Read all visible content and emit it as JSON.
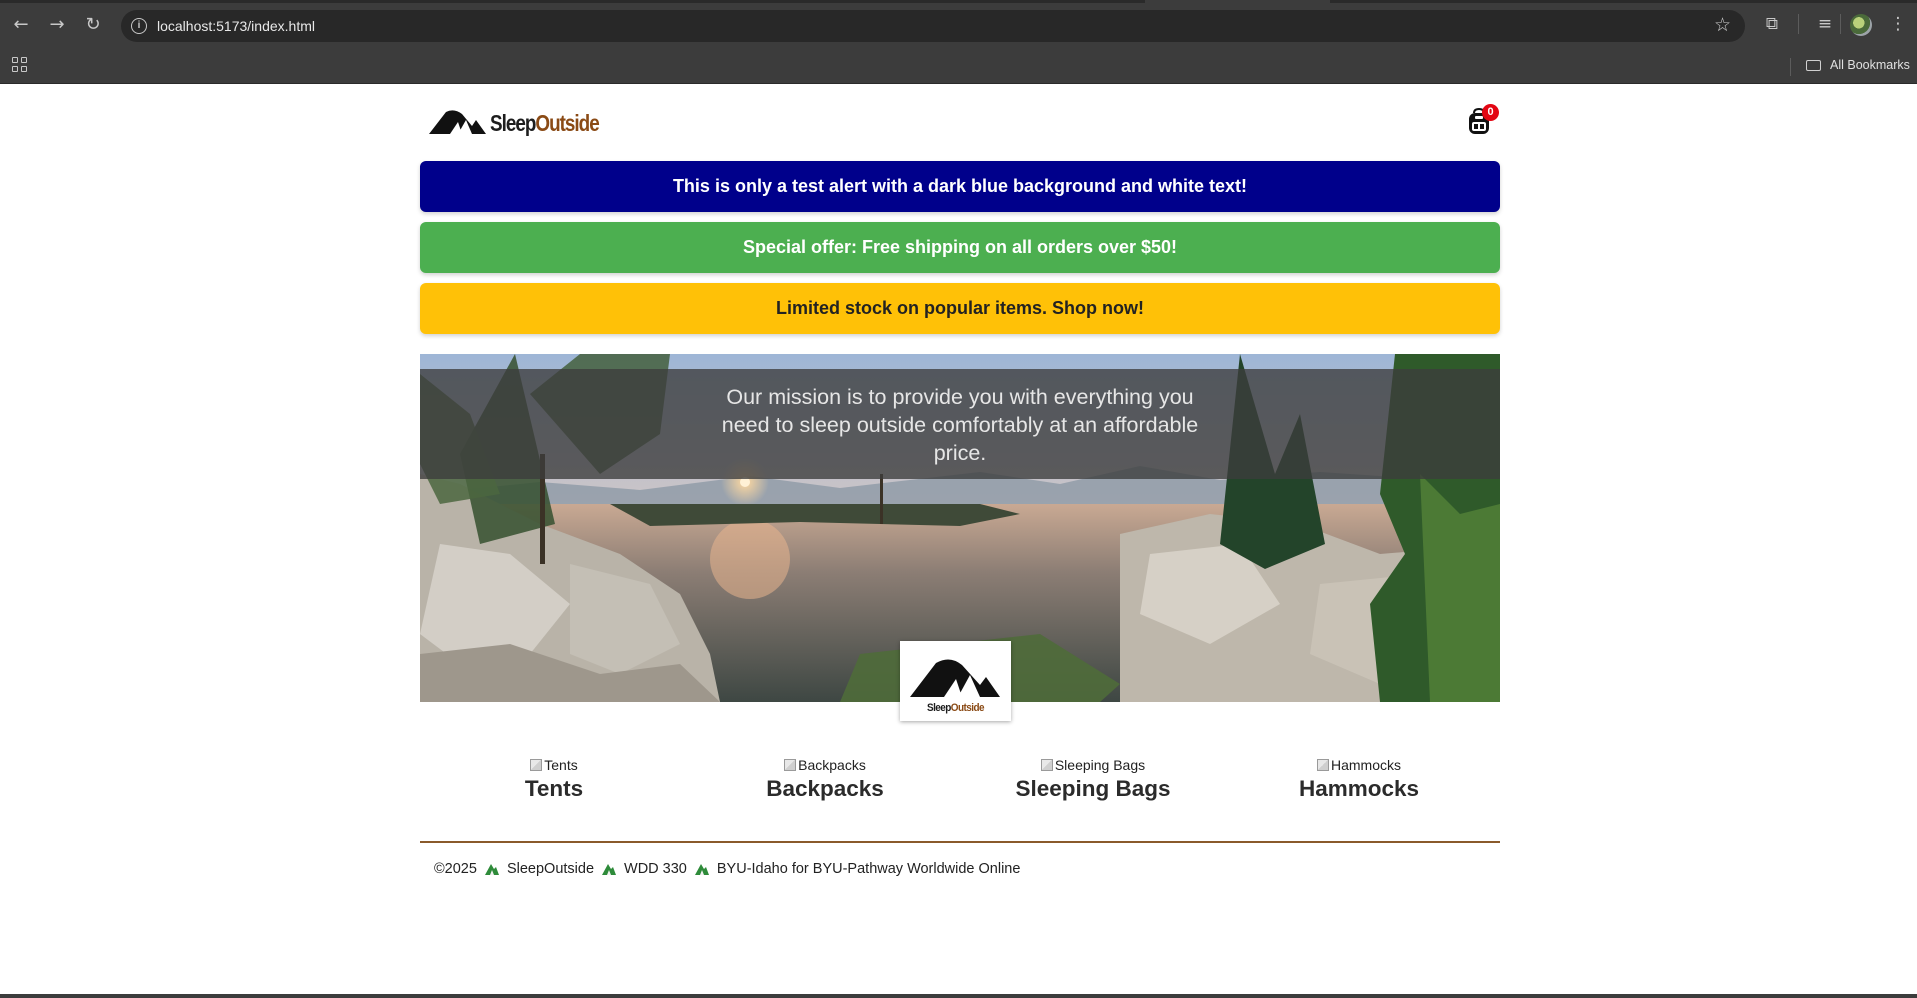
{
  "browser": {
    "url": "localhost:5173/index.html",
    "bookmarks_label": "All Bookmarks",
    "icons": [
      "back-icon",
      "forward-icon",
      "reload-icon",
      "site-info-icon",
      "bookmark-star-icon",
      "extensions-icon",
      "tab-search-icon",
      "profile-avatar",
      "more-menu-icon",
      "apps-grid-icon",
      "folder-icon"
    ]
  },
  "header": {
    "logo_text_1": "Sleep",
    "logo_text_2": "Outside",
    "cart_count": "0"
  },
  "alerts": [
    {
      "message": "This is only a test alert with a dark blue background and white text!",
      "background": "#00008b",
      "color": "#ffffff"
    },
    {
      "message": "Special offer: Free shipping on all orders over $50!",
      "background": "#4caf50",
      "color": "#ffffff"
    },
    {
      "message": "Limited stock on popular items. Shop now!",
      "background": "#ffc107",
      "color": "#222222"
    }
  ],
  "hero": {
    "mission": "Our mission is to provide you with everything you need to sleep outside comfortably at an affordable price.",
    "logo_text_1": "Sleep",
    "logo_text_2": "Outside"
  },
  "products": [
    {
      "alt": "Tents",
      "name": "Tents"
    },
    {
      "alt": "Backpacks",
      "name": "Backpacks"
    },
    {
      "alt": "Sleeping Bags",
      "name": "Sleeping Bags"
    },
    {
      "alt": "Hammocks",
      "name": "Hammocks"
    }
  ],
  "footer": {
    "copyright": "©2025",
    "brand": "SleepOutside",
    "course": "WDD 330",
    "school": "BYU-Idaho for BYU-Pathway Worldwide Online"
  },
  "colors": {
    "brand_brown": "#8a4a15",
    "footer_rule": "#8a5a2b",
    "cart_badge": "#e30613"
  }
}
